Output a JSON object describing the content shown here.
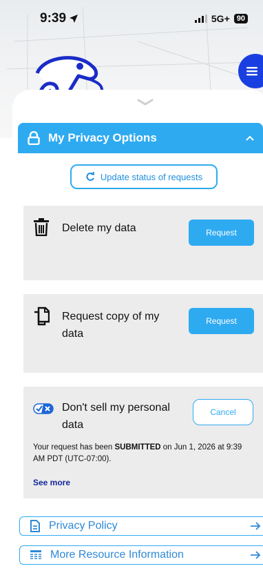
{
  "status_bar": {
    "time": "9:39",
    "network": "5G+",
    "battery": "90"
  },
  "header": {
    "title": "My Privacy Options"
  },
  "update_button": {
    "label": "Update status of requests"
  },
  "cards": [
    {
      "title": "Delete my data",
      "button": "Request"
    },
    {
      "title_line1": "Request copy of my",
      "title_line2": "data",
      "button": "Request"
    },
    {
      "title_line1": "Don't sell my personal",
      "title_line2": "data",
      "button": "Cancel",
      "status_prefix": "Your request has been ",
      "status_bold": "SUBMITTED",
      "status_suffix": " on Jun 1, 2026 at 9:39 AM PDT (UTC-07:00).",
      "see_more": "See more"
    }
  ],
  "links": [
    {
      "label": "Privacy Policy"
    },
    {
      "label": "More Resource Information"
    }
  ],
  "colors": {
    "accent": "#2eaaf1",
    "fab": "#1a3fe0",
    "card_bg": "#ececec",
    "link_text": "#2e89d6"
  }
}
